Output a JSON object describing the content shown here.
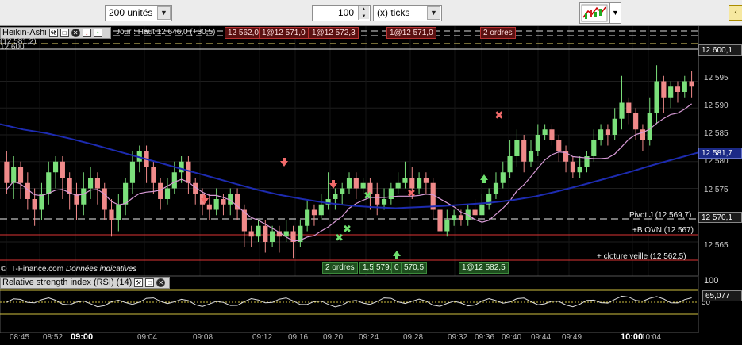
{
  "toolbar": {
    "units_select": "200 unités",
    "count_value": "100",
    "ticks_select": "(x) ticks"
  },
  "chart": {
    "title": "Heikin-Ashi",
    "subtitle": "(12 581,2)",
    "partial_label": "12 600",
    "day_high": "Jour : Haut 12 646,0 (+30,5)",
    "order_tags_top": [
      "12 562,0",
      "1@12 571,0",
      "1@12 572,3",
      "1@12 571,0",
      "2 ordres"
    ],
    "order_tags_bottom": [
      "2 ordres",
      "1,5",
      "579,0",
      "0",
      "570,5",
      "1@12 582,5"
    ],
    "pivot": "Pivot J (12 569,7)",
    "b_ovn": "+B OVN (12 567)",
    "cloture": "+ cloture veille  (12 562,5)",
    "credit": "© IT-Finance.com",
    "credit_italic": "Données indicatives",
    "price_axis": [
      "12 595",
      "12 590",
      "12 585",
      "12 580",
      "12 575",
      "12 565"
    ],
    "price_tags": {
      "top": "12 600,1",
      "mid": "12 581,7",
      "pivot": "12 570,1"
    }
  },
  "rsi": {
    "title": "Relative strength index (RSI) (14)",
    "axis_top": "100",
    "axis_mid": "50",
    "value": "65,077"
  },
  "time_axis": [
    "08:45",
    "08:52",
    "09:00",
    "09:04",
    "09:08",
    "09:12",
    "09:16",
    "09:20",
    "09:24",
    "09:28",
    "09:32",
    "09:36",
    "09:40",
    "09:44",
    "09:49",
    "10:00",
    "10:04"
  ],
  "colors": {
    "bull": "#7be07b",
    "bear": "#f08a8a",
    "ma_blue": "#1d2bb0",
    "ma_pink": "#d79ad6"
  },
  "chart_data": {
    "type": "candlestick",
    "title": "Heikin-Ashi",
    "ylim": [
      12561,
      12601
    ],
    "reference_lines": [
      {
        "name": "Pivot J",
        "value": 12569.7
      },
      {
        "name": "+B OVN",
        "value": 12567
      },
      {
        "name": "+ cloture veille",
        "value": 12562.5
      }
    ],
    "current": {
      "price": 12600.1,
      "ma": 12581.7
    },
    "candles": [
      [
        12580,
        12576,
        12582,
        12574
      ],
      [
        12576,
        12579,
        12581,
        12573
      ],
      [
        12579,
        12576,
        12580,
        12573
      ],
      [
        12576,
        12573,
        12578,
        12571
      ],
      [
        12573,
        12571,
        12575,
        12568
      ],
      [
        12571,
        12574,
        12576,
        12569
      ],
      [
        12574,
        12578,
        12580,
        12572
      ],
      [
        12578,
        12580,
        12581,
        12575
      ],
      [
        12580,
        12577,
        12581,
        12573
      ],
      [
        12577,
        12574,
        12578,
        12571
      ],
      [
        12574,
        12572,
        12576,
        12569
      ],
      [
        12572,
        12575,
        12578,
        12570
      ],
      [
        12575,
        12577,
        12579,
        12573
      ],
      [
        12577,
        12575,
        12578,
        12572
      ],
      [
        12575,
        12571,
        12576,
        12569
      ],
      [
        12571,
        12569,
        12573,
        12566
      ],
      [
        12569,
        12572,
        12574,
        12567
      ],
      [
        12572,
        12576,
        12577,
        12570
      ],
      [
        12576,
        12580,
        12582,
        12574
      ],
      [
        12580,
        12582,
        12583,
        12578
      ],
      [
        12582,
        12579,
        12583,
        12576
      ],
      [
        12579,
        12576,
        12580,
        12574
      ],
      [
        12576,
        12573,
        12577,
        12571
      ],
      [
        12573,
        12575,
        12577,
        12572
      ],
      [
        12575,
        12578,
        12580,
        12574
      ],
      [
        12578,
        12580,
        12581,
        12576
      ],
      [
        12580,
        12576,
        12581,
        12574
      ],
      [
        12576,
        12574,
        12577,
        12572
      ],
      [
        12574,
        12572,
        12575,
        12570
      ],
      [
        12572,
        12571,
        12574,
        12569
      ],
      [
        12571,
        12573,
        12575,
        12570
      ],
      [
        12573,
        12572,
        12574,
        12570
      ],
      [
        12572,
        12574,
        12575,
        12570
      ],
      [
        12574,
        12571,
        12575,
        12569
      ],
      [
        12571,
        12567,
        12572,
        12564
      ],
      [
        12567,
        12566,
        12568,
        12564
      ],
      [
        12566,
        12568,
        12569,
        12565
      ],
      [
        12568,
        12565,
        12569,
        12563
      ],
      [
        12565,
        12567,
        12568,
        12564
      ],
      [
        12567,
        12566,
        12568,
        12563
      ],
      [
        12566,
        12567,
        12569,
        12565
      ],
      [
        12567,
        12565,
        12568,
        12562
      ],
      [
        12565,
        12568,
        12569,
        12564
      ],
      [
        12568,
        12571,
        12573,
        12567
      ],
      [
        12571,
        12570,
        12572,
        12568
      ],
      [
        12570,
        12572,
        12574,
        12569
      ],
      [
        12572,
        12573,
        12578,
        12571
      ],
      [
        12573,
        12574,
        12575,
        12571
      ],
      [
        12574,
        12575,
        12576,
        12572
      ],
      [
        12575,
        12577,
        12578,
        12574
      ],
      [
        12577,
        12575,
        12578,
        12573
      ],
      [
        12575,
        12576,
        12577,
        12574
      ],
      [
        12576,
        12574,
        12577,
        12571
      ],
      [
        12574,
        12572,
        12576,
        12570
      ],
      [
        12572,
        12573,
        12575,
        12571
      ],
      [
        12573,
        12575,
        12576,
        12572
      ],
      [
        12575,
        12576,
        12578,
        12574
      ],
      [
        12576,
        12577,
        12580,
        12575
      ],
      [
        12577,
        12575,
        12579,
        12573
      ],
      [
        12575,
        12577,
        12578,
        12574
      ],
      [
        12577,
        12576,
        12578,
        12574
      ],
      [
        12576,
        12571,
        12577,
        12569
      ],
      [
        12571,
        12567,
        12572,
        12565
      ],
      [
        12567,
        12569,
        12571,
        12566
      ],
      [
        12569,
        12570,
        12571,
        12568
      ],
      [
        12570,
        12569,
        12571,
        12568
      ],
      [
        12569,
        12571,
        12572,
        12568
      ],
      [
        12571,
        12570,
        12573,
        12569
      ],
      [
        12570,
        12572,
        12574,
        12570
      ],
      [
        12572,
        12574,
        12575,
        12571
      ],
      [
        12574,
        12576,
        12578,
        12573
      ],
      [
        12576,
        12578,
        12580,
        12575
      ],
      [
        12578,
        12581,
        12584,
        12577
      ],
      [
        12581,
        12584,
        12586,
        12579
      ],
      [
        12584,
        12580,
        12585,
        12578
      ],
      [
        12580,
        12582,
        12584,
        12579
      ],
      [
        12582,
        12585,
        12587,
        12581
      ],
      [
        12585,
        12586,
        12587,
        12584
      ],
      [
        12586,
        12584,
        12587,
        12583
      ],
      [
        12584,
        12582,
        12585,
        12580
      ],
      [
        12582,
        12580,
        12583,
        12578
      ],
      [
        12580,
        12578,
        12581,
        12577
      ],
      [
        12578,
        12579,
        12581,
        12577
      ],
      [
        12579,
        12581,
        12582,
        12578
      ],
      [
        12581,
        12584,
        12586,
        12580
      ],
      [
        12584,
        12586,
        12587,
        12583
      ],
      [
        12586,
        12585,
        12587,
        12583
      ],
      [
        12585,
        12588,
        12590,
        12584
      ],
      [
        12588,
        12591,
        12596,
        12586
      ],
      [
        12591,
        12589,
        12592,
        12587
      ],
      [
        12589,
        12586,
        12590,
        12584
      ],
      [
        12586,
        12584,
        12587,
        12582
      ],
      [
        12584,
        12589,
        12592,
        12583
      ],
      [
        12589,
        12595,
        12598,
        12587
      ],
      [
        12595,
        12592,
        12596,
        12589
      ],
      [
        12592,
        12594,
        12595,
        12590
      ],
      [
        12594,
        12593,
        12595,
        12591
      ],
      [
        12593,
        12595,
        12596,
        12592
      ],
      [
        12595,
        12594,
        12597,
        12592
      ]
    ]
  }
}
